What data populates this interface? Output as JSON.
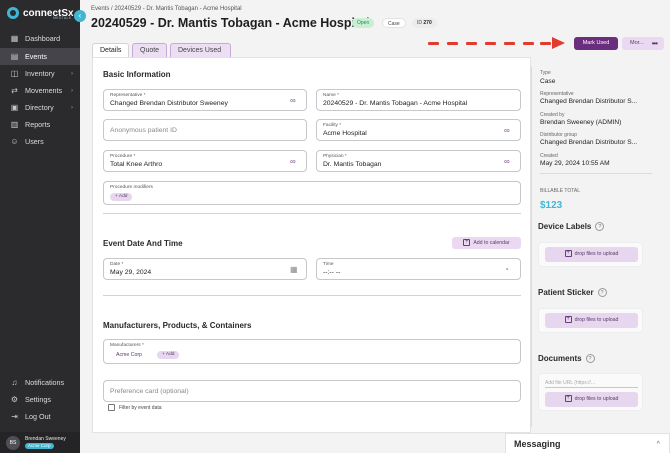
{
  "app": {
    "logo": "connectSx",
    "logo_sub": "MEDTALK"
  },
  "sidebar": {
    "items": [
      {
        "label": "Dashboard",
        "icon": "dashboard-icon"
      },
      {
        "label": "Events",
        "icon": "calendar-icon",
        "active": true
      },
      {
        "label": "Inventory",
        "icon": "box-icon"
      },
      {
        "label": "Movements",
        "icon": "arrows-icon"
      },
      {
        "label": "Directory",
        "icon": "directory-icon"
      },
      {
        "label": "Reports",
        "icon": "report-icon"
      },
      {
        "label": "Users",
        "icon": "users-icon"
      }
    ],
    "bottom_items": [
      {
        "label": "Notifications",
        "icon": "bell-icon"
      },
      {
        "label": "Settings",
        "icon": "gear-icon"
      },
      {
        "label": "Log Out",
        "icon": "logout-icon"
      }
    ],
    "user": {
      "initials": "BS",
      "name": "Brendan Sweeney",
      "org": "Acme Corp"
    }
  },
  "header": {
    "breadcrumb": "Events / 20240529 - Dr. Mantis Tobagan - Acme Hospital",
    "title": "20240529 - Dr. Mantis Tobagan - Acme Hospital",
    "status": "Open",
    "type_badge": "Case",
    "id_label": "ID",
    "id_value": "270"
  },
  "tabs": [
    "Details",
    "Quote",
    "Devices Used"
  ],
  "actions": {
    "mark_used": "Mark Used",
    "more": "Mor..."
  },
  "basic_info": {
    "title": "Basic Information",
    "representative": {
      "label": "Representative *",
      "value": "Changed Brendan Distributor Sweeney"
    },
    "name": {
      "label": "Name *",
      "value": "20240529 - Dr. Mantis Tobagan - Acme Hospital"
    },
    "anon_patient_placeholder": "Anonymous patient ID",
    "facility": {
      "label": "Facility *",
      "value": "Acme Hospital"
    },
    "procedure": {
      "label": "Procedure *",
      "value": "Total Knee Arthro"
    },
    "physician": {
      "label": "Physician *",
      "value": "Dr. Mantis Tobagan"
    },
    "procedure_modifiers": {
      "label": "Procedure modifiers",
      "add": "+ Add"
    }
  },
  "event_date": {
    "title": "Event Date And Time",
    "add_calendar": "Add to calendar",
    "date": {
      "label": "Date *",
      "value": "May 29, 2024"
    },
    "time": {
      "label": "Time",
      "value": "--:-- --"
    }
  },
  "manufacturers": {
    "title": "Manufacturers, Products, & Containers",
    "label": "Manufacturers *",
    "chip": "Acme Corp",
    "add": "+ Add",
    "preference_placeholder": "Preference card (optional)",
    "filter_label": "Filter by event data"
  },
  "right_panel": {
    "type_label": "Type",
    "type_value": "Case",
    "rep_label": "Representative",
    "rep_value": "Changed Brendan Distributor S...",
    "created_by_label": "Created by",
    "created_by_value": "Brendan Sweeney (ADMIN)",
    "dist_group_label": "Distributor group",
    "dist_group_value": "Changed Brendan Distributor S...",
    "created_label": "Created",
    "created_value": "May 29, 2024 10:55 AM",
    "billable_label": "BILLABLE TOTAL",
    "billable_value": "$123",
    "device_labels": "Device Labels",
    "patient_sticker": "Patient Sticker",
    "documents": "Documents",
    "drop_text": "drop files to upload",
    "url_placeholder": "Add file URL (https://..."
  },
  "messaging": {
    "title": "Messaging"
  },
  "colors": {
    "accent": "#6b2e7e",
    "brand": "#3fb7d3",
    "sidebar": "#2b2b2d",
    "arrow": "#e23b2e"
  }
}
